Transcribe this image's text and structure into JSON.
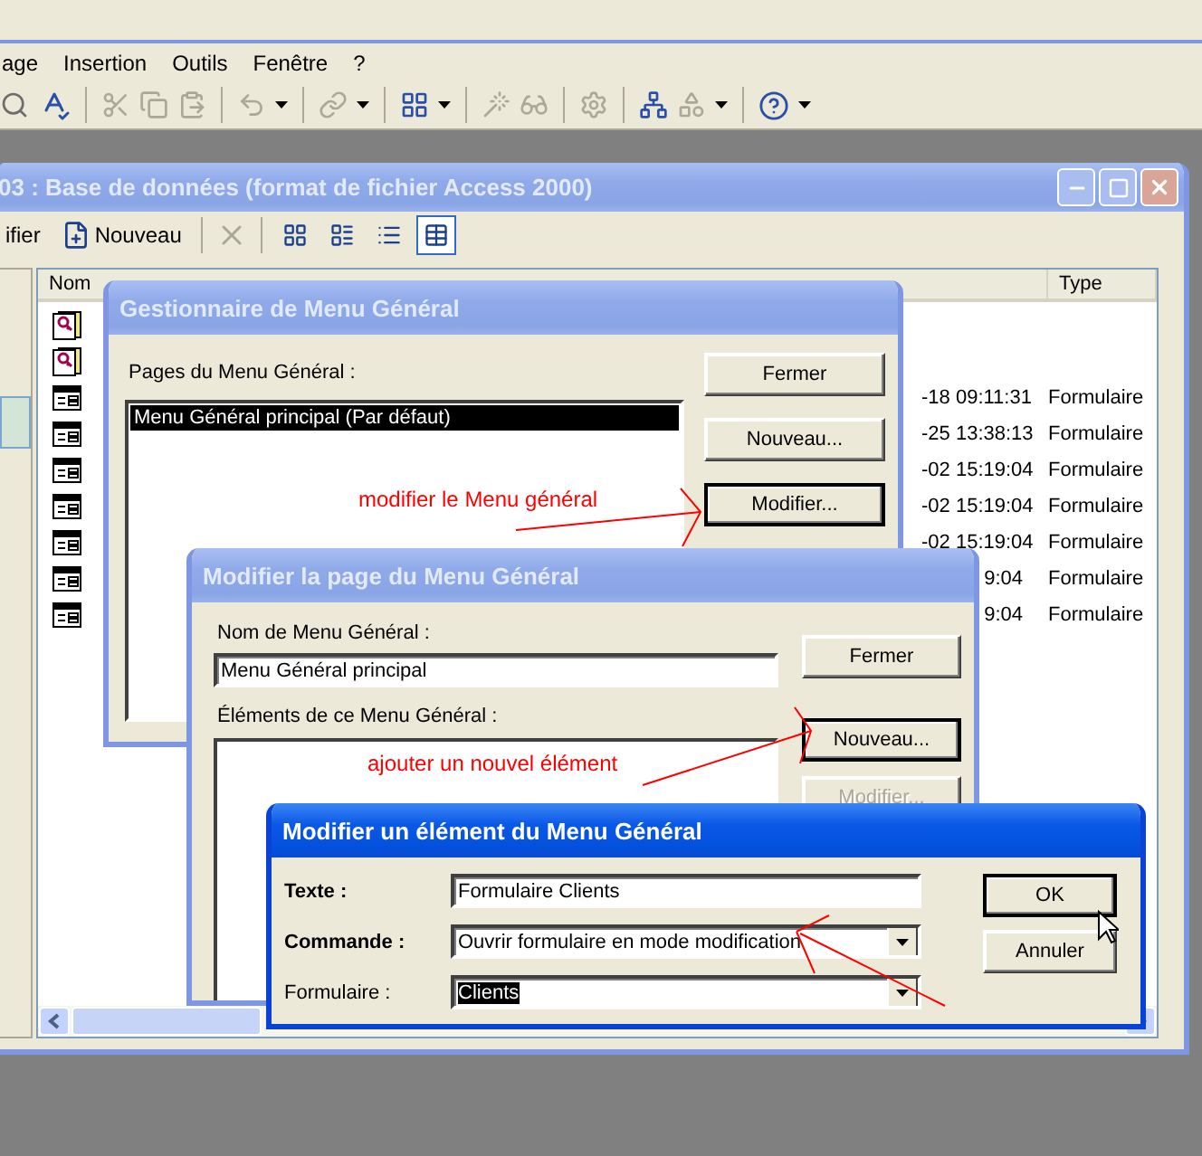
{
  "menu_bar": [
    {
      "label": "age"
    },
    {
      "label": "Insertion"
    },
    {
      "label": "Outils"
    },
    {
      "label": "Fenêtre"
    },
    {
      "label": "?"
    }
  ],
  "database_window": {
    "title": "03 : Base de données (format de fichier Access 2000)",
    "toolbar": [
      {
        "label": "ifier"
      },
      {
        "label": "Nouveau"
      }
    ],
    "view_buttons": [
      {
        "selected": false
      },
      {
        "selected": false
      },
      {
        "selected": false
      },
      {
        "selected": true
      }
    ],
    "object_bar": [
      {
        "selected": true
      }
    ],
    "columns": [
      {
        "label": "Nom"
      },
      {
        "label": "Type"
      }
    ],
    "rows": [
      {
        "kind": "macro"
      },
      {
        "kind": "macro"
      },
      {
        "kind": "form",
        "modified": "-18 09:11:31",
        "type": "Formulaire"
      },
      {
        "kind": "form",
        "modified": "-25 13:38:13",
        "type": "Formulaire"
      },
      {
        "kind": "form",
        "modified": "-02 15:19:04",
        "type": "Formulaire"
      },
      {
        "kind": "form",
        "modified": "-02 15:19:04",
        "type": "Formulaire"
      },
      {
        "kind": "form",
        "modified": "-02 15:19:04",
        "type": "Formulaire"
      },
      {
        "kind": "form",
        "modified": "9:04",
        "type": "Formulaire"
      },
      {
        "kind": "form",
        "modified": "9:04",
        "type": "Formulaire"
      }
    ]
  },
  "switchboard_manager": {
    "title": "Gestionnaire de Menu Général",
    "pages_label": "Pages du Menu Général :",
    "pages": [
      {
        "label": "Menu Général principal (Par défaut)",
        "selected": true
      }
    ],
    "buttons": [
      {
        "label": "Fermer",
        "focused": false
      },
      {
        "label": "Nouveau...",
        "focused": false
      },
      {
        "label": "Modifier...",
        "focused": true
      }
    ]
  },
  "page_editor": {
    "title": "Modifier la page du Menu Général",
    "name_label": "Nom de Menu Général :",
    "name_value": "Menu Général principal",
    "items_label": "Éléments de ce Menu Général :",
    "buttons": [
      {
        "label": "Fermer",
        "focused": false,
        "disabled": false
      },
      {
        "label": "Nouveau...",
        "focused": true,
        "disabled": false
      },
      {
        "label": "Modifier...",
        "focused": false,
        "disabled": true
      }
    ]
  },
  "item_editor": {
    "title": "Modifier un élément du Menu Général",
    "fields": [
      {
        "kind": "text",
        "label": "Texte :",
        "bold": true,
        "value": "Formulaire Clients",
        "highlighted": false
      },
      {
        "kind": "dropdown",
        "label": "Commande :",
        "bold": true,
        "value": "Ouvrir formulaire en mode modification",
        "highlighted": false
      },
      {
        "kind": "dropdown",
        "label": "Formulaire :",
        "bold": false,
        "value": "Clients",
        "highlighted": true
      }
    ],
    "buttons": [
      {
        "label": "OK",
        "focused": true
      },
      {
        "label": "Annuler",
        "focused": false
      }
    ]
  },
  "annotations": [
    {
      "text": "modifier le Menu général"
    },
    {
      "text": "ajouter un nouvel élément"
    }
  ]
}
